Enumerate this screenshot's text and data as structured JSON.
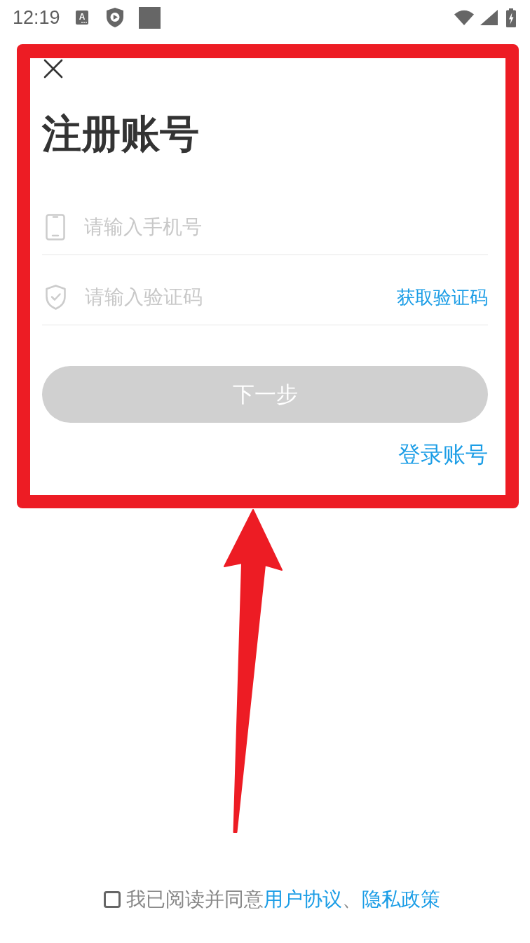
{
  "status_bar": {
    "time": "12:19",
    "notification_icons": [
      {
        "kind": "letter",
        "glyph": "A"
      },
      {
        "kind": "shield-play"
      },
      {
        "kind": "square"
      }
    ],
    "system_icons": [
      {
        "kind": "wifi"
      },
      {
        "kind": "signal"
      },
      {
        "kind": "battery-charging"
      }
    ]
  },
  "title": "注册账号",
  "fields": [
    {
      "kind": "phone",
      "placeholder": "请输入手机号"
    },
    {
      "kind": "code",
      "placeholder": "请输入验证码",
      "action": "获取验证码"
    }
  ],
  "next_button": {
    "label": "下一步",
    "disabled": true
  },
  "login_link": "登录账号",
  "agreement": {
    "checked": false,
    "text": "我已阅读并同意",
    "links": [
      "用户协议",
      "隐私政策"
    ],
    "separator": "、"
  },
  "annotations": {
    "highlight_frame": true,
    "pointer_arrow": true
  }
}
